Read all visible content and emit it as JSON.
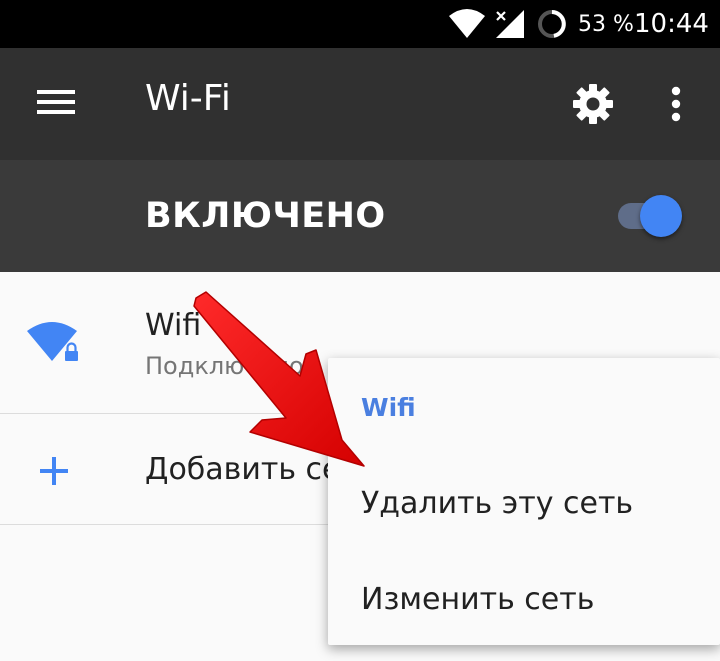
{
  "status_bar": {
    "battery_percent": "53 %",
    "time": "10:44",
    "icons": [
      "wifi-signal-icon",
      "cellular-no-data-icon",
      "battery-icon"
    ]
  },
  "app_bar": {
    "title": "Wi-Fi",
    "icons": [
      "menu-icon",
      "gear-icon",
      "more-vert-icon"
    ]
  },
  "master_switch": {
    "label": "ВКЛЮЧЕНО",
    "on": true
  },
  "networks": [
    {
      "name": "Wifi",
      "status": "Подключено",
      "icon": "wifi-lock-icon"
    }
  ],
  "add_network": {
    "label": "Добавить сеть",
    "icon": "plus-icon"
  },
  "context_menu": {
    "title": "Wifi",
    "items": [
      "Удалить эту сеть",
      "Изменить сеть"
    ]
  },
  "colors": {
    "accent": "#4285f4",
    "app_bar": "#303030",
    "annotation_arrow": "#e00000"
  }
}
